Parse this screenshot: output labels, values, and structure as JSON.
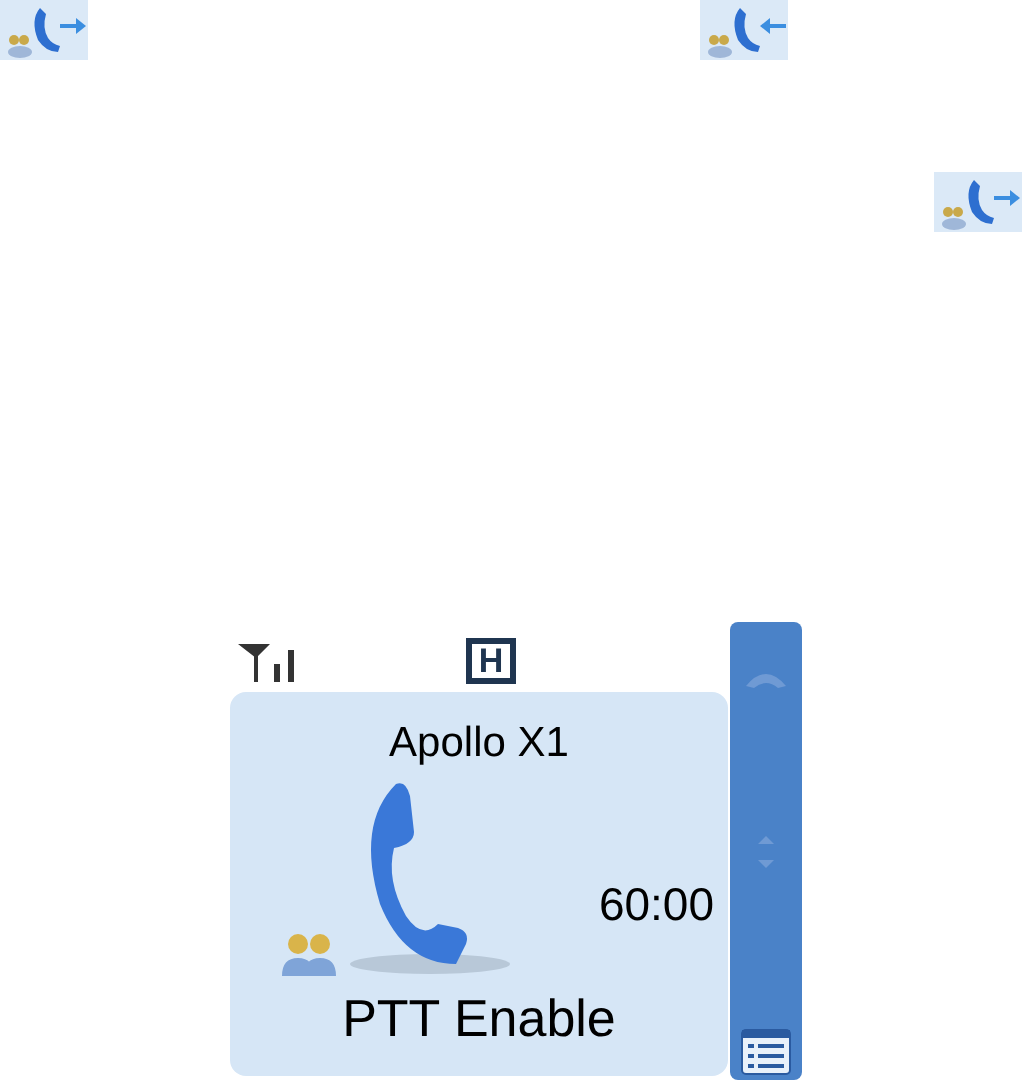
{
  "call_icons": [
    {
      "kind": "outgoing"
    },
    {
      "kind": "incoming"
    },
    {
      "kind": "outgoing"
    }
  ],
  "phone": {
    "status_bar": {
      "network_mode": "H"
    },
    "call": {
      "name": "Apollo X1",
      "timer": "60:00",
      "status": "PTT Enable"
    }
  }
}
